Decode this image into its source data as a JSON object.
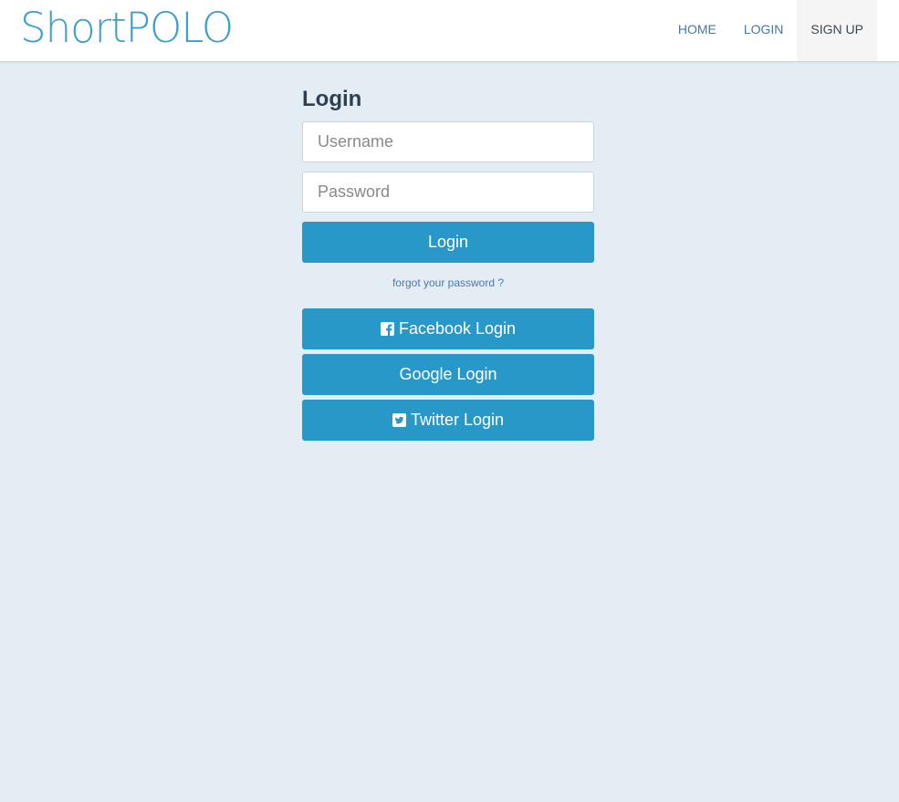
{
  "brand": {
    "name_light": "Short",
    "name_bold": "POLO",
    "color": "#3aa0cc"
  },
  "nav": {
    "items": [
      {
        "label": "HOME"
      },
      {
        "label": "LOGIN"
      },
      {
        "label": "SIGN UP",
        "active": true
      }
    ]
  },
  "login": {
    "title": "Login",
    "username_placeholder": "Username",
    "username_value": "",
    "password_placeholder": "Password",
    "password_value": "",
    "submit_label": "Login",
    "forgot_label": "forgot your password ?"
  },
  "social": {
    "facebook": {
      "label": "Facebook Login",
      "icon": "facebook-square-icon"
    },
    "google": {
      "label": "Google Login"
    },
    "twitter": {
      "label": "Twitter Login",
      "icon": "twitter-square-icon"
    }
  },
  "colors": {
    "accent": "#2898c8",
    "background": "#e4edf3",
    "nav_link": "#4a78a0"
  }
}
